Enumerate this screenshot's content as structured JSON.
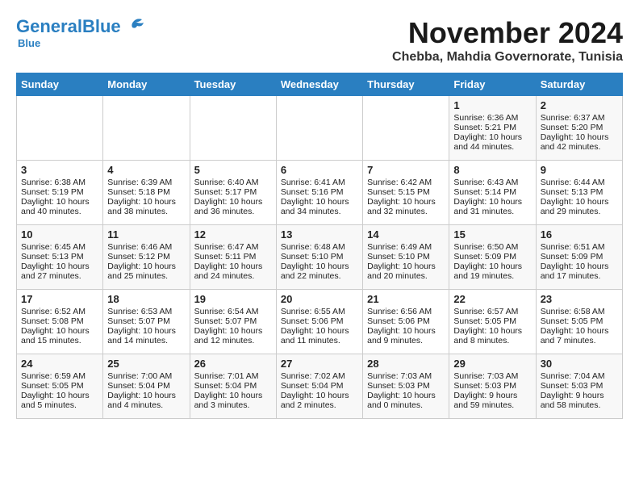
{
  "header": {
    "logo_general": "General",
    "logo_blue": "Blue",
    "month": "November 2024",
    "location": "Chebba, Mahdia Governorate, Tunisia"
  },
  "days_of_week": [
    "Sunday",
    "Monday",
    "Tuesday",
    "Wednesday",
    "Thursday",
    "Friday",
    "Saturday"
  ],
  "weeks": [
    [
      {
        "day": "",
        "sunrise": "",
        "sunset": "",
        "daylight": ""
      },
      {
        "day": "",
        "sunrise": "",
        "sunset": "",
        "daylight": ""
      },
      {
        "day": "",
        "sunrise": "",
        "sunset": "",
        "daylight": ""
      },
      {
        "day": "",
        "sunrise": "",
        "sunset": "",
        "daylight": ""
      },
      {
        "day": "",
        "sunrise": "",
        "sunset": "",
        "daylight": ""
      },
      {
        "day": "1",
        "sunrise": "Sunrise: 6:36 AM",
        "sunset": "Sunset: 5:21 PM",
        "daylight": "Daylight: 10 hours and 44 minutes."
      },
      {
        "day": "2",
        "sunrise": "Sunrise: 6:37 AM",
        "sunset": "Sunset: 5:20 PM",
        "daylight": "Daylight: 10 hours and 42 minutes."
      }
    ],
    [
      {
        "day": "3",
        "sunrise": "Sunrise: 6:38 AM",
        "sunset": "Sunset: 5:19 PM",
        "daylight": "Daylight: 10 hours and 40 minutes."
      },
      {
        "day": "4",
        "sunrise": "Sunrise: 6:39 AM",
        "sunset": "Sunset: 5:18 PM",
        "daylight": "Daylight: 10 hours and 38 minutes."
      },
      {
        "day": "5",
        "sunrise": "Sunrise: 6:40 AM",
        "sunset": "Sunset: 5:17 PM",
        "daylight": "Daylight: 10 hours and 36 minutes."
      },
      {
        "day": "6",
        "sunrise": "Sunrise: 6:41 AM",
        "sunset": "Sunset: 5:16 PM",
        "daylight": "Daylight: 10 hours and 34 minutes."
      },
      {
        "day": "7",
        "sunrise": "Sunrise: 6:42 AM",
        "sunset": "Sunset: 5:15 PM",
        "daylight": "Daylight: 10 hours and 32 minutes."
      },
      {
        "day": "8",
        "sunrise": "Sunrise: 6:43 AM",
        "sunset": "Sunset: 5:14 PM",
        "daylight": "Daylight: 10 hours and 31 minutes."
      },
      {
        "day": "9",
        "sunrise": "Sunrise: 6:44 AM",
        "sunset": "Sunset: 5:13 PM",
        "daylight": "Daylight: 10 hours and 29 minutes."
      }
    ],
    [
      {
        "day": "10",
        "sunrise": "Sunrise: 6:45 AM",
        "sunset": "Sunset: 5:13 PM",
        "daylight": "Daylight: 10 hours and 27 minutes."
      },
      {
        "day": "11",
        "sunrise": "Sunrise: 6:46 AM",
        "sunset": "Sunset: 5:12 PM",
        "daylight": "Daylight: 10 hours and 25 minutes."
      },
      {
        "day": "12",
        "sunrise": "Sunrise: 6:47 AM",
        "sunset": "Sunset: 5:11 PM",
        "daylight": "Daylight: 10 hours and 24 minutes."
      },
      {
        "day": "13",
        "sunrise": "Sunrise: 6:48 AM",
        "sunset": "Sunset: 5:10 PM",
        "daylight": "Daylight: 10 hours and 22 minutes."
      },
      {
        "day": "14",
        "sunrise": "Sunrise: 6:49 AM",
        "sunset": "Sunset: 5:10 PM",
        "daylight": "Daylight: 10 hours and 20 minutes."
      },
      {
        "day": "15",
        "sunrise": "Sunrise: 6:50 AM",
        "sunset": "Sunset: 5:09 PM",
        "daylight": "Daylight: 10 hours and 19 minutes."
      },
      {
        "day": "16",
        "sunrise": "Sunrise: 6:51 AM",
        "sunset": "Sunset: 5:09 PM",
        "daylight": "Daylight: 10 hours and 17 minutes."
      }
    ],
    [
      {
        "day": "17",
        "sunrise": "Sunrise: 6:52 AM",
        "sunset": "Sunset: 5:08 PM",
        "daylight": "Daylight: 10 hours and 15 minutes."
      },
      {
        "day": "18",
        "sunrise": "Sunrise: 6:53 AM",
        "sunset": "Sunset: 5:07 PM",
        "daylight": "Daylight: 10 hours and 14 minutes."
      },
      {
        "day": "19",
        "sunrise": "Sunrise: 6:54 AM",
        "sunset": "Sunset: 5:07 PM",
        "daylight": "Daylight: 10 hours and 12 minutes."
      },
      {
        "day": "20",
        "sunrise": "Sunrise: 6:55 AM",
        "sunset": "Sunset: 5:06 PM",
        "daylight": "Daylight: 10 hours and 11 minutes."
      },
      {
        "day": "21",
        "sunrise": "Sunrise: 6:56 AM",
        "sunset": "Sunset: 5:06 PM",
        "daylight": "Daylight: 10 hours and 9 minutes."
      },
      {
        "day": "22",
        "sunrise": "Sunrise: 6:57 AM",
        "sunset": "Sunset: 5:05 PM",
        "daylight": "Daylight: 10 hours and 8 minutes."
      },
      {
        "day": "23",
        "sunrise": "Sunrise: 6:58 AM",
        "sunset": "Sunset: 5:05 PM",
        "daylight": "Daylight: 10 hours and 7 minutes."
      }
    ],
    [
      {
        "day": "24",
        "sunrise": "Sunrise: 6:59 AM",
        "sunset": "Sunset: 5:05 PM",
        "daylight": "Daylight: 10 hours and 5 minutes."
      },
      {
        "day": "25",
        "sunrise": "Sunrise: 7:00 AM",
        "sunset": "Sunset: 5:04 PM",
        "daylight": "Daylight: 10 hours and 4 minutes."
      },
      {
        "day": "26",
        "sunrise": "Sunrise: 7:01 AM",
        "sunset": "Sunset: 5:04 PM",
        "daylight": "Daylight: 10 hours and 3 minutes."
      },
      {
        "day": "27",
        "sunrise": "Sunrise: 7:02 AM",
        "sunset": "Sunset: 5:04 PM",
        "daylight": "Daylight: 10 hours and 2 minutes."
      },
      {
        "day": "28",
        "sunrise": "Sunrise: 7:03 AM",
        "sunset": "Sunset: 5:03 PM",
        "daylight": "Daylight: 10 hours and 0 minutes."
      },
      {
        "day": "29",
        "sunrise": "Sunrise: 7:03 AM",
        "sunset": "Sunset: 5:03 PM",
        "daylight": "Daylight: 9 hours and 59 minutes."
      },
      {
        "day": "30",
        "sunrise": "Sunrise: 7:04 AM",
        "sunset": "Sunset: 5:03 PM",
        "daylight": "Daylight: 9 hours and 58 minutes."
      }
    ]
  ]
}
